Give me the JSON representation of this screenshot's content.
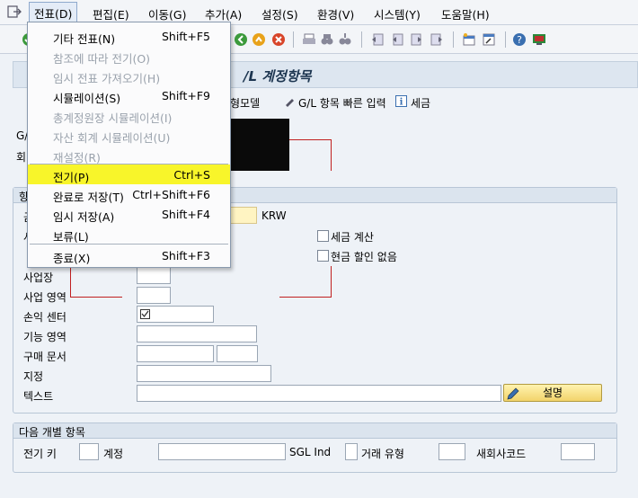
{
  "menubar": {
    "items": [
      "전표(D)",
      "편집(E)",
      "이동(G)",
      "추가(A)",
      "설정(S)",
      "환경(V)",
      "시스템(Y)",
      "도움말(H)"
    ]
  },
  "window": {
    "title": "/L 계정항목"
  },
  "appbar": {
    "model_label": "형모델",
    "gl_quick_label": "G/L 항목 빠른 입력",
    "tax_label": "세금"
  },
  "header": {
    "gl_label": "G/",
    "company_label": "회"
  },
  "amount_panel": {
    "title": "항",
    "amount_prefix": "금",
    "currency": "KRW",
    "tax_calc_label": "세금 계산",
    "no_cash_discount_label": "현금 할인 없음",
    "rows": {
      "business_place": "사업장",
      "business_area": "사업 영역",
      "profit_center": "손익 센터",
      "functional_area": "기능 영역",
      "purchasing_doc": "구매 문서",
      "assignment": "지정",
      "text": "텍스트"
    },
    "desc_button": "설명"
  },
  "next_item": {
    "title": "다음 개별 항목",
    "posting_key": "전기 키",
    "account": "계정",
    "sgl_ind": "SGL Ind",
    "trans_type": "거래 유형",
    "new_company_code": "새회사코드"
  },
  "dropdown": {
    "items": [
      {
        "label": "기타 전표(N)",
        "shortcut": "Shift+F5",
        "disabled": false
      },
      {
        "label": "참조에 따라 전기(O)",
        "shortcut": "",
        "disabled": true
      },
      {
        "label": "임시 전표 가져오기(H)",
        "shortcut": "",
        "disabled": true
      },
      {
        "label": "시뮬레이션(S)",
        "shortcut": "Shift+F9",
        "disabled": false
      },
      {
        "label": "총계정원장 시뮬레이션(I)",
        "shortcut": "",
        "disabled": true
      },
      {
        "label": "자산 회계 시뮬레이션(U)",
        "shortcut": "",
        "disabled": true
      },
      {
        "label": "재설정(R)",
        "shortcut": "",
        "disabled": true
      },
      {
        "label": "전기(P)",
        "shortcut": "Ctrl+S",
        "disabled": false
      },
      {
        "label": "완료로 저장(T)",
        "shortcut": "Ctrl+Shift+F6",
        "disabled": false
      },
      {
        "label": "임시 저장(A)",
        "shortcut": "Shift+F4",
        "disabled": false
      },
      {
        "label": "보류(L)",
        "shortcut": "",
        "disabled": false
      },
      {
        "label": "종료(X)",
        "shortcut": "Shift+F3",
        "disabled": false
      }
    ]
  },
  "colors": {
    "highlight": "#f8f52a",
    "required_field": "#fff4c2",
    "title_text": "#1c3550"
  }
}
